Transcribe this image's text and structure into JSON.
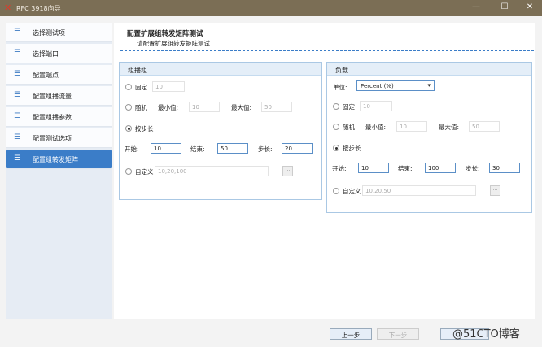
{
  "window": {
    "title": "RFC 3918向导",
    "minimize": "—",
    "maximize": "☐",
    "close": "✕"
  },
  "sidebar": {
    "items": [
      {
        "label": "选择测试项"
      },
      {
        "label": "选择端口"
      },
      {
        "label": "配置端点"
      },
      {
        "label": "配置组播流量"
      },
      {
        "label": "配置组播参数"
      },
      {
        "label": "配置测试选项"
      },
      {
        "label": "配置组转发矩阵",
        "active": true
      }
    ]
  },
  "header": {
    "title": "配置扩展组转发矩阵测试",
    "subtitle": "请配置扩展组转发矩阵测试"
  },
  "multicast_group": {
    "title": "组播组",
    "fixed_label": "固定",
    "fixed_value": "10",
    "random_label": "随机",
    "min_label": "最小值:",
    "min_value": "10",
    "max_label": "最大值:",
    "max_value": "50",
    "step_mode_label": "按步长",
    "start_label": "开始:",
    "start_value": "10",
    "end_label": "结束:",
    "end_value": "50",
    "step_label": "步长:",
    "step_value": "20",
    "custom_label": "自定义",
    "custom_value": "10,20,100",
    "browse": "..."
  },
  "load": {
    "title": "负载",
    "unit_label": "单位:",
    "unit_value": "Percent (%)",
    "fixed_label": "固定",
    "fixed_value": "10",
    "random_label": "随机",
    "min_label": "最小值:",
    "min_value": "10",
    "max_label": "最大值:",
    "max_value": "50",
    "step_mode_label": "按步长",
    "start_label": "开始:",
    "start_value": "10",
    "end_label": "结束:",
    "end_value": "100",
    "step_label": "步长:",
    "step_value": "30",
    "custom_label": "自定义",
    "custom_value": "10,20,50",
    "browse": "..."
  },
  "footer": {
    "prev": "上一步",
    "next": "下一步",
    "watermark": "@51CTO博客"
  },
  "colors": {
    "accent": "#3b7dc8",
    "titlebar": "#7b6e55"
  }
}
